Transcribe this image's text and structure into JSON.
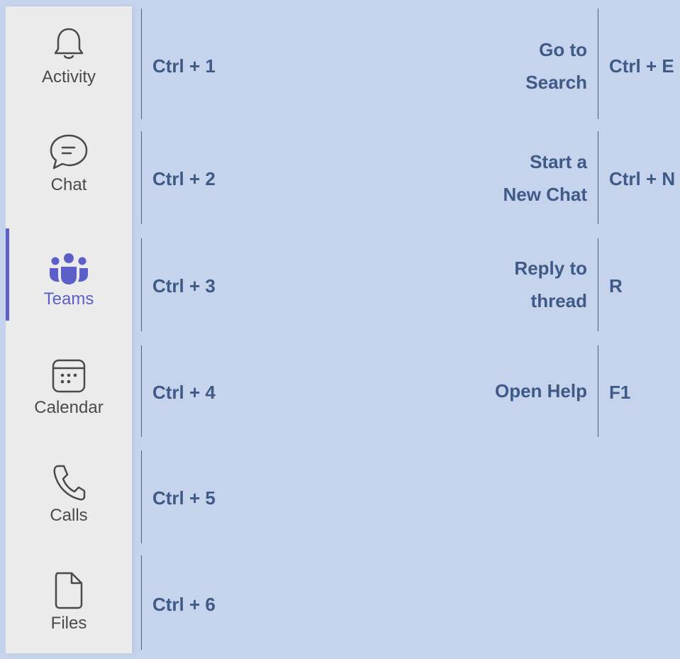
{
  "sidebar": {
    "items": [
      {
        "label": "Activity",
        "icon": "bell-icon",
        "shortcut": "Ctrl + 1"
      },
      {
        "label": "Chat",
        "icon": "chat-icon",
        "shortcut": "Ctrl + 2"
      },
      {
        "label": "Teams",
        "icon": "teams-icon",
        "shortcut": "Ctrl + 3",
        "active": true
      },
      {
        "label": "Calendar",
        "icon": "calendar-icon",
        "shortcut": "Ctrl + 4"
      },
      {
        "label": "Calls",
        "icon": "phone-icon",
        "shortcut": "Ctrl + 5"
      },
      {
        "label": "Files",
        "icon": "file-icon",
        "shortcut": "Ctrl + 6"
      }
    ]
  },
  "shortcuts": [
    {
      "action_line1": "Go to",
      "action_line2": "Search",
      "key": "Ctrl + E"
    },
    {
      "action_line1": "Start a",
      "action_line2": "New Chat",
      "key": "Ctrl + N"
    },
    {
      "action_line1": "Reply to",
      "action_line2": "thread",
      "key": "R"
    },
    {
      "action_line1": "Open Help",
      "action_line2": "",
      "key": "F1"
    }
  ],
  "colors": {
    "background": "#c5d3ec",
    "sidebar": "#ebebeb",
    "accent": "#5b5fc7",
    "text": "#3f5a86"
  }
}
